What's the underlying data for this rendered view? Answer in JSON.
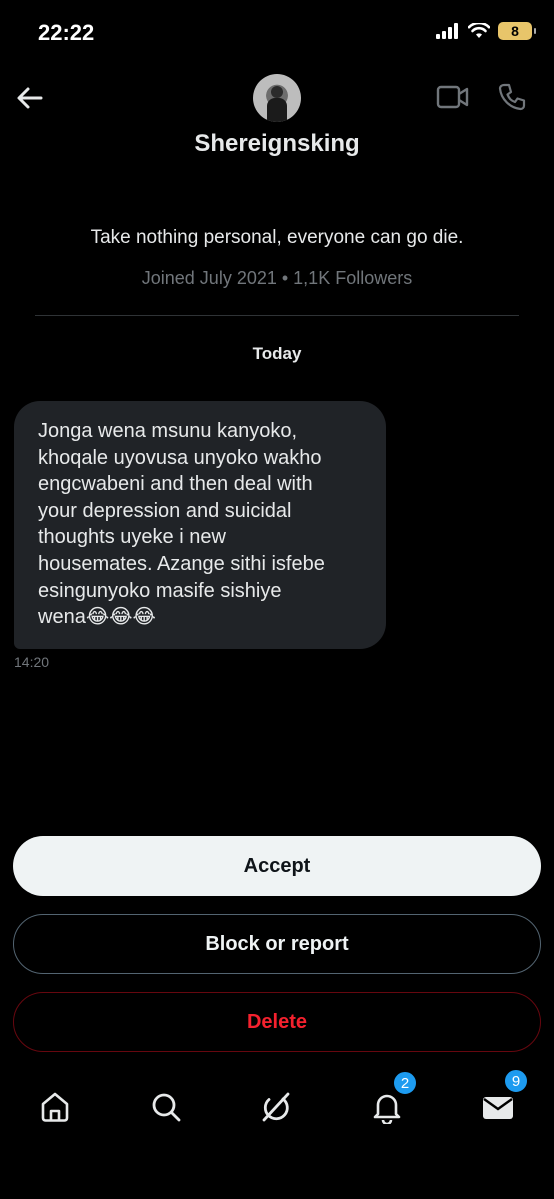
{
  "status_bar": {
    "time": "22:22",
    "battery": "8"
  },
  "header": {
    "username": "Shereignsking"
  },
  "profile": {
    "bio": "Take nothing personal, everyone can go die.",
    "meta": "Joined July 2021 • 1,1K Followers"
  },
  "conversation": {
    "date_divider": "Today",
    "messages": [
      {
        "text": "Jonga wena msunu kanyoko,\nkhoqale uyovusa unyoko wakho\nengcwabeni and then deal with\nyour depression and suicidal\nthoughts uyeke i new\nhousemates. Azange sithi isfebe\nesingunyoko masife sishiye\nwena😂😂😂",
        "time": "14:20"
      }
    ]
  },
  "actions": {
    "accept": "Accept",
    "block_or_report": "Block or report",
    "delete": "Delete"
  },
  "nav": {
    "notifications_badge": "2",
    "messages_badge": "9"
  },
  "colors": {
    "accent": "#1d9bf0",
    "danger": "#f4212e",
    "bubble": "#202327",
    "muted": "#71767b"
  },
  "icons": [
    "back-arrow-icon",
    "video-call-icon",
    "phone-icon",
    "home-icon",
    "search-icon",
    "grok-icon",
    "bell-icon",
    "mail-icon"
  ]
}
